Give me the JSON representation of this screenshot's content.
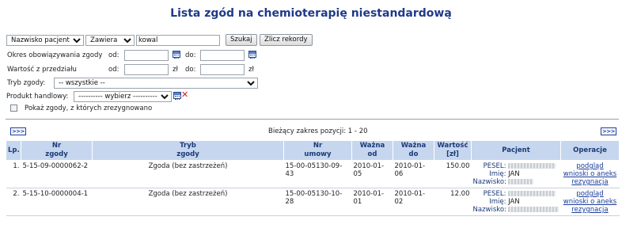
{
  "page_title": "Lista zgód na chemioterapię niestandardową",
  "search": {
    "field_select": "Nazwisko pacjenta",
    "operator_select": "Zawiera",
    "value": "kowal",
    "search_button": "Szukaj",
    "count_button": "Zlicz rekordy"
  },
  "filters": {
    "validity_label": "Okres obowiązywania zgody",
    "from_label": "od:",
    "to_label": "do:",
    "value_range_label": "Wartość z przedziału",
    "currency": "zł",
    "mode_label": "Tryb zgody:",
    "mode_value": "-- wszystkie --",
    "product_label": "Produkt handlowy:",
    "product_value": "---------- wybierz ----------",
    "withdrawn_label": "Pokaż zgody, z których zrezygnowano"
  },
  "pager": {
    "prev_label": ">>>",
    "next_label": ">>>",
    "range_text": "Bieżący zakres pozycji: 1 - 20"
  },
  "table": {
    "headers": {
      "lp": "Lp.",
      "nr_zgody_1": "Nr",
      "nr_zgody_2": "zgody",
      "tryb_1": "Tryb",
      "tryb_2": "zgody",
      "nr_umowy_1": "Nr",
      "nr_umowy_2": "umowy",
      "wazna_od_1": "Ważna",
      "wazna_od_2": "od",
      "wazna_do_1": "Ważna",
      "wazna_do_2": "do",
      "wartosc_1": "Wartość",
      "wartosc_2": "[zł]",
      "pacjent": "Pacjent",
      "operacje": "Operacje"
    },
    "patient_labels": {
      "pesel": "PESEL:",
      "imie": "Imię:",
      "nazwisko": "Nazwisko:"
    },
    "rows": [
      {
        "lp": "1.",
        "nr_zgody": "5-15-09-0000062-2",
        "tryb": "Zgoda (bez zastrzeżeń)",
        "nr_umowy": "15-00-05130-09-43",
        "wazna_od": "2010-01-05",
        "wazna_do": "2010-01-06",
        "wartosc": "150.00",
        "imie": "JAN",
        "op_podglad": "podgląd",
        "op_wnioski": "wnioski o aneks",
        "op_rezygnacja": "rezygnacja"
      },
      {
        "lp": "2.",
        "nr_zgody": "5-15-10-0000004-1",
        "tryb": "Zgoda (bez zastrzeżeń)",
        "nr_umowy": "15-00-05130-10-28",
        "wazna_od": "2010-01-01",
        "wazna_do": "2010-01-02",
        "wartosc": "12.00",
        "imie": "JAN",
        "op_podglad": "podgląd",
        "op_wnioski": "wnioski o aneks",
        "op_rezygnacja": "rezygnacja"
      }
    ]
  },
  "icons": {
    "calendar": "calendar-icon",
    "clear": "clear-x-icon",
    "checkbox": "checkbox"
  },
  "colors": {
    "title": "#1f3a8a",
    "header_bg": "#c6d6ee",
    "link": "#1a3c9c",
    "clear_x": "#d21e1e"
  }
}
